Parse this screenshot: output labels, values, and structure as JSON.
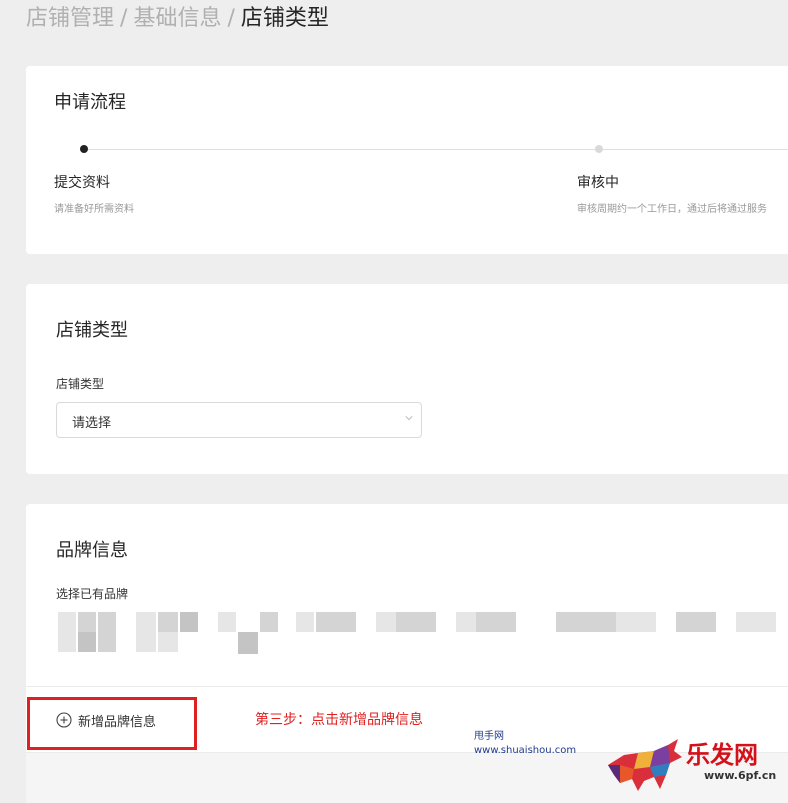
{
  "breadcrumb": {
    "items": [
      "店铺管理",
      "基础信息"
    ],
    "separator": "/",
    "current": "店铺类型"
  },
  "process": {
    "title": "申请流程",
    "steps": [
      {
        "title": "提交资料",
        "desc": "请准备好所需资料",
        "status": "active"
      },
      {
        "title": "审核中",
        "desc": "审核周期约一个工作日，通过后将通过服务",
        "status": "pending"
      }
    ]
  },
  "store_type": {
    "title": "店铺类型",
    "field_label": "店铺类型",
    "select_value": "请选择"
  },
  "brand": {
    "title": "品牌信息",
    "field_label": "选择已有品牌",
    "add_label": "新增品牌信息"
  },
  "annotation": {
    "step_note": "第三步：点击新增品牌信息",
    "highlight_color": "#e02020"
  },
  "watermarks": {
    "site_name": "甩手网",
    "site_url": "www.shuaishou.com",
    "brand_text": "乐发网",
    "brand_url": "www.6pf.cn"
  }
}
